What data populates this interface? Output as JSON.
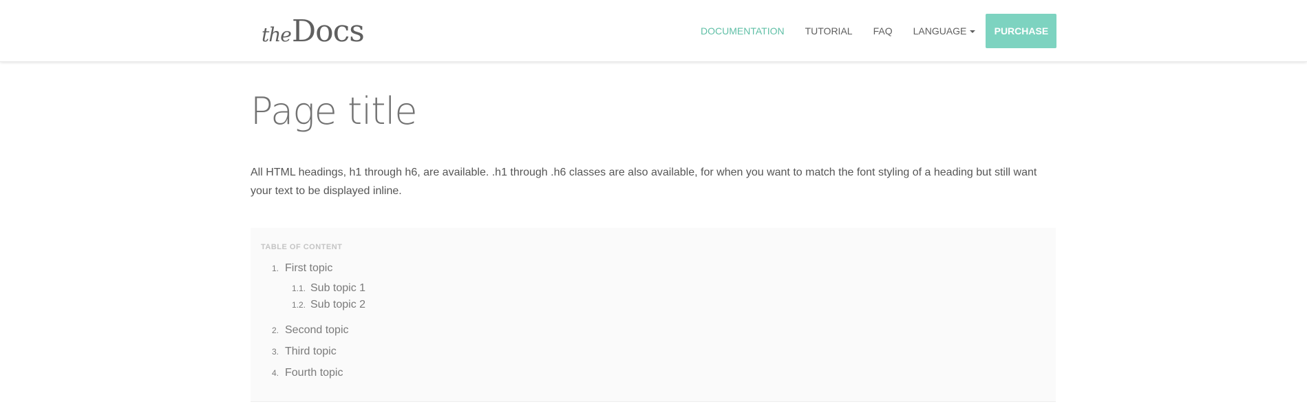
{
  "brand": {
    "the": "the",
    "docs": "Docs"
  },
  "nav": {
    "documentation": "DOCUMENTATION",
    "tutorial": "TUTORIAL",
    "faq": "FAQ",
    "language": "LANGUAGE",
    "purchase": "PURCHASE",
    "active_color": "#5fbfa6",
    "purchase_color": "#7dd3c0"
  },
  "main": {
    "title": "Page title",
    "intro": "All HTML headings, h1 through h6, are available. .h1 through .h6 classes are also available, for when you want to match the font styling of a heading but still want your text to be displayed inline."
  },
  "toc": {
    "title": "TABLE OF CONTENT",
    "items": [
      {
        "num": "1.",
        "label": "First topic",
        "subs": [
          {
            "num": "1.1.",
            "label": "Sub topic 1"
          },
          {
            "num": "1.2.",
            "label": "Sub topic 2"
          }
        ]
      },
      {
        "num": "2.",
        "label": "Second topic"
      },
      {
        "num": "3.",
        "label": "Third topic"
      },
      {
        "num": "4.",
        "label": "Fourth topic"
      }
    ]
  }
}
